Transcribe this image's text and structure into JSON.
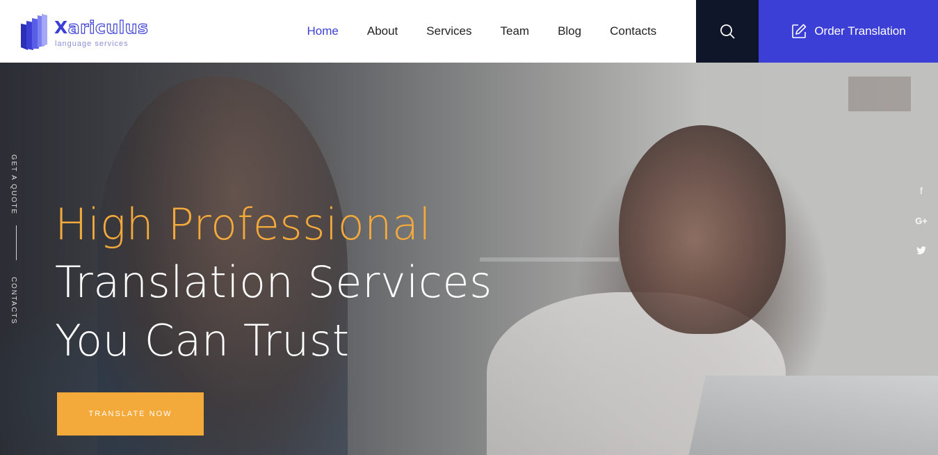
{
  "brand": {
    "name_first": "X",
    "name_rest": "ariculus",
    "tagline": "language services",
    "accent": "#3b3fd6",
    "logo_icon": "book-stack-icon"
  },
  "nav": {
    "items": [
      {
        "label": "Home",
        "active": true
      },
      {
        "label": "About",
        "active": false
      },
      {
        "label": "Services",
        "active": false
      },
      {
        "label": "Team",
        "active": false
      },
      {
        "label": "Blog",
        "active": false
      },
      {
        "label": "Contacts",
        "active": false
      }
    ]
  },
  "header": {
    "search_icon": "search-icon",
    "order_button": {
      "label": "Order Translation",
      "icon": "edit-icon",
      "color": "#3b3fd6"
    }
  },
  "hero": {
    "line1": "High Professional",
    "line2": "Translation Services",
    "line3": "You Can Trust",
    "line1_color": "#f4a93b",
    "cta_label": "TRANSLATE NOW",
    "cta_color": "#f4a93b",
    "side_links": [
      "GET A QUOTE",
      "CONTACTS"
    ],
    "social": [
      {
        "icon": "facebook-icon",
        "glyph": "f"
      },
      {
        "icon": "google-plus-icon",
        "glyph": "G+"
      },
      {
        "icon": "twitter-icon",
        "glyph": "t"
      }
    ]
  }
}
